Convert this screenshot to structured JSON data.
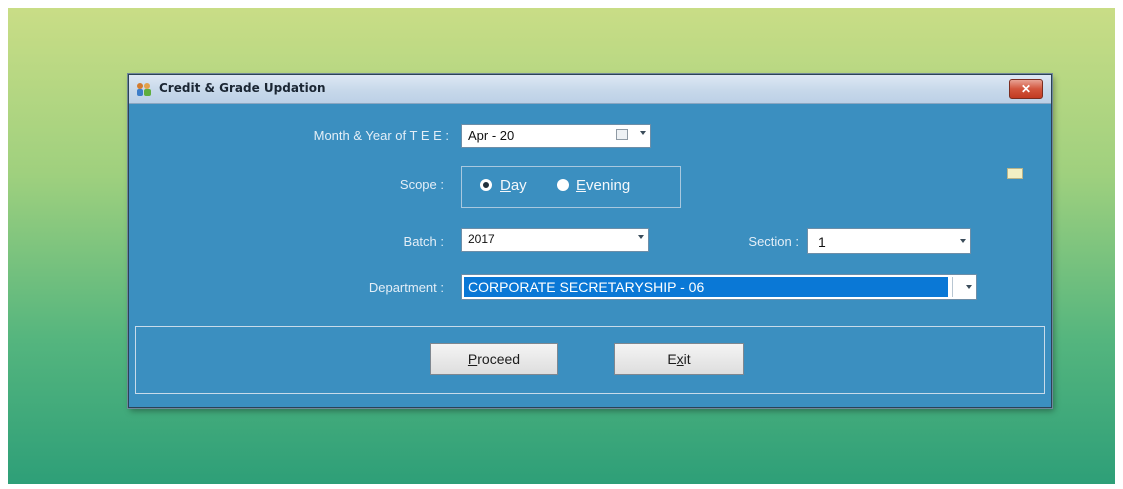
{
  "window": {
    "title": "Credit & Grade Updation",
    "close_label": "✕"
  },
  "form": {
    "month_year_label": "Month & Year of T E E :",
    "month_year_value": "Apr  - 20",
    "scope_label": "Scope :",
    "scope_options": [
      {
        "first": "D",
        "rest": "ay",
        "checked": true
      },
      {
        "first": "E",
        "rest": "vening",
        "checked": false
      }
    ],
    "batch_label": "Batch :",
    "batch_value": "2017",
    "section_label": "Section :",
    "section_value": "1",
    "department_label": "Department :",
    "department_value": "CORPORATE SECRETARYSHIP - 06"
  },
  "buttons": {
    "proceed_first": "P",
    "proceed_rest": "roceed",
    "exit_first": "E",
    "exit_mid": "x",
    "exit_rest": "it"
  },
  "colors": {
    "window_bg": "#3b8fc0",
    "selection": "#0a78d6",
    "backdrop_top": "#c9dd86",
    "backdrop_bottom": "#2e9f78"
  },
  "icons": {
    "app": "people-icon",
    "calendar": "calendar-icon",
    "dropdown": "chevron-down-icon"
  }
}
